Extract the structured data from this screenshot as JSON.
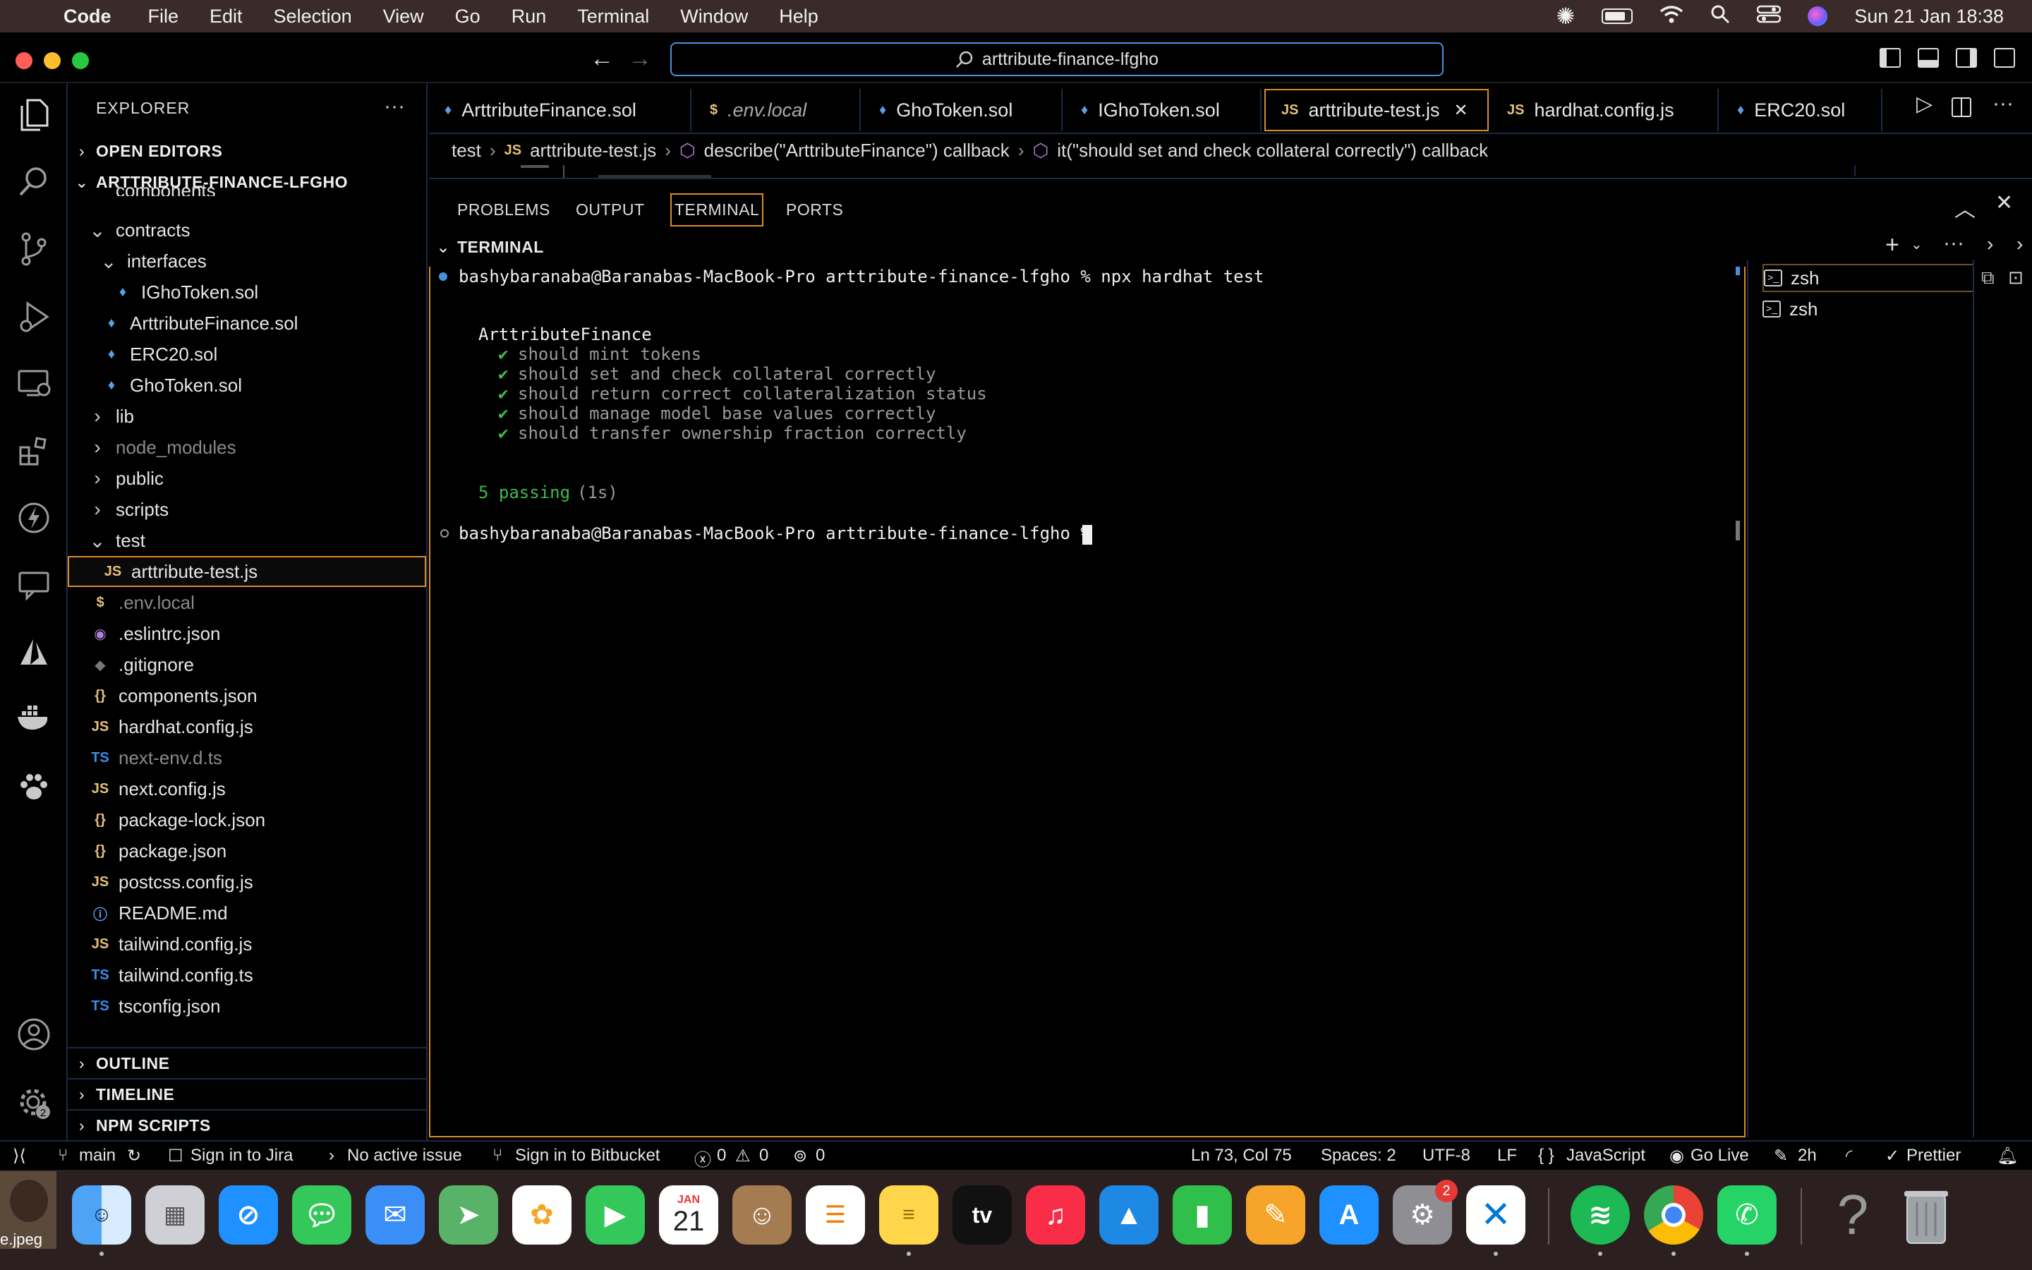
{
  "menubar": {
    "app_name": "Code",
    "items": [
      "File",
      "Edit",
      "Selection",
      "View",
      "Go",
      "Run",
      "Terminal",
      "Window",
      "Help"
    ],
    "clock": "Sun 21 Jan  18:38"
  },
  "titlebar": {
    "search_text": "arttribute-finance-lfgho"
  },
  "explorer": {
    "title": "EXPLORER",
    "open_editors": "OPEN EDITORS",
    "project": "ARTTRIBUTE-FINANCE-LFGHO",
    "tree": [
      {
        "label": "components",
        "icon": "",
        "kind": "folder-partial"
      },
      {
        "label": "contracts",
        "icon": "v",
        "kind": "folder-open"
      },
      {
        "label": "interfaces",
        "icon": "v",
        "kind": "folder-open"
      },
      {
        "label": "IGhoToken.sol",
        "icon": "♦",
        "kind": "sol"
      },
      {
        "label": "ArttributeFinance.sol",
        "icon": "♦",
        "kind": "sol"
      },
      {
        "label": "ERC20.sol",
        "icon": "♦",
        "kind": "sol"
      },
      {
        "label": "GhoToken.sol",
        "icon": "♦",
        "kind": "sol"
      },
      {
        "label": "lib",
        "icon": ">",
        "kind": "folder"
      },
      {
        "label": "node_modules",
        "icon": ">",
        "kind": "folder-dim"
      },
      {
        "label": "public",
        "icon": ">",
        "kind": "folder"
      },
      {
        "label": "scripts",
        "icon": ">",
        "kind": "folder"
      },
      {
        "label": "test",
        "icon": "v",
        "kind": "folder-open"
      },
      {
        "label": "arttribute-test.js",
        "icon": "JS",
        "kind": "js-selected"
      },
      {
        "label": ".env.local",
        "icon": "$",
        "kind": "env"
      },
      {
        "label": ".eslintrc.json",
        "icon": "◉",
        "kind": "eslint"
      },
      {
        "label": ".gitignore",
        "icon": "◆",
        "kind": "git"
      },
      {
        "label": "components.json",
        "icon": "{}",
        "kind": "json"
      },
      {
        "label": "hardhat.config.js",
        "icon": "JS",
        "kind": "js"
      },
      {
        "label": "next-env.d.ts",
        "icon": "TS",
        "kind": "ts-dim"
      },
      {
        "label": "next.config.js",
        "icon": "JS",
        "kind": "js"
      },
      {
        "label": "package-lock.json",
        "icon": "{}",
        "kind": "json"
      },
      {
        "label": "package.json",
        "icon": "{}",
        "kind": "json"
      },
      {
        "label": "postcss.config.js",
        "icon": "JS",
        "kind": "js"
      },
      {
        "label": "README.md",
        "icon": "ⓘ",
        "kind": "md"
      },
      {
        "label": "tailwind.config.js",
        "icon": "JS",
        "kind": "js"
      },
      {
        "label": "tailwind.config.ts",
        "icon": "TS",
        "kind": "ts"
      },
      {
        "label": "tsconfig.json",
        "icon": "TS",
        "kind": "tsjson"
      }
    ],
    "outline": "OUTLINE",
    "timeline": "TIMELINE",
    "npm_scripts": "NPM SCRIPTS"
  },
  "tabs": [
    {
      "label": "ArttributeFinance.sol",
      "icon": "♦"
    },
    {
      "label": ".env.local",
      "icon": "$"
    },
    {
      "label": "GhoToken.sol",
      "icon": "♦"
    },
    {
      "label": "IGhoToken.sol",
      "icon": "♦"
    },
    {
      "label": "arttribute-test.js",
      "icon": "JS",
      "active": true
    },
    {
      "label": "hardhat.config.js",
      "icon": "JS"
    },
    {
      "label": "ERC20.sol",
      "icon": "♦"
    }
  ],
  "breadcrumb": {
    "folder": "test",
    "file": "arttribute-test.js",
    "describe": "describe(\"ArttributeFinance\") callback",
    "it": "it(\"should set and check collateral correctly\") callback"
  },
  "panel": {
    "tabs": [
      "PROBLEMS",
      "OUTPUT",
      "TERMINAL",
      "PORTS"
    ],
    "active_tab": "TERMINAL",
    "section_title": "TERMINAL"
  },
  "terminal": {
    "prompt1": "bashybaranaba@Baranabas-MacBook-Pro arttribute-finance-lfgho % npx hardhat test",
    "suite": "ArttributeFinance",
    "tests": [
      "should mint tokens",
      "should set and check collateral correctly",
      "should return correct collateralization status",
      "should manage model base values correctly",
      "should transfer ownership fraction correctly"
    ],
    "check_mark": "✔",
    "passing": "5 passing",
    "duration": "(1s)",
    "prompt2": "bashybaranaba@Baranabas-MacBook-Pro arttribute-finance-lfgho % ",
    "instances": [
      "zsh",
      "zsh"
    ]
  },
  "statusbar": {
    "branch": "main",
    "jira": "Sign in to Jira",
    "issue": "No active issue",
    "bitbucket": "Sign in to Bitbucket",
    "errors": "0",
    "warnings": "0",
    "ports": "0",
    "position": "Ln 73, Col 75",
    "spaces": "Spaces: 2",
    "encoding": "UTF-8",
    "eol": "LF",
    "language": "JavaScript",
    "golive": "Go Live",
    "time": "2h",
    "prettier": "Prettier"
  },
  "dock": {
    "calendar_month": "JAN",
    "calendar_day": "21",
    "settings_badge": "2",
    "tv_label": "tv",
    "desktop_file": "e.jpeg"
  },
  "colors": {
    "accent_border": "#d98c2b",
    "command_center_border": "#4a90d9",
    "check_green": "#3fb950",
    "passing_green": "#3fb950"
  }
}
